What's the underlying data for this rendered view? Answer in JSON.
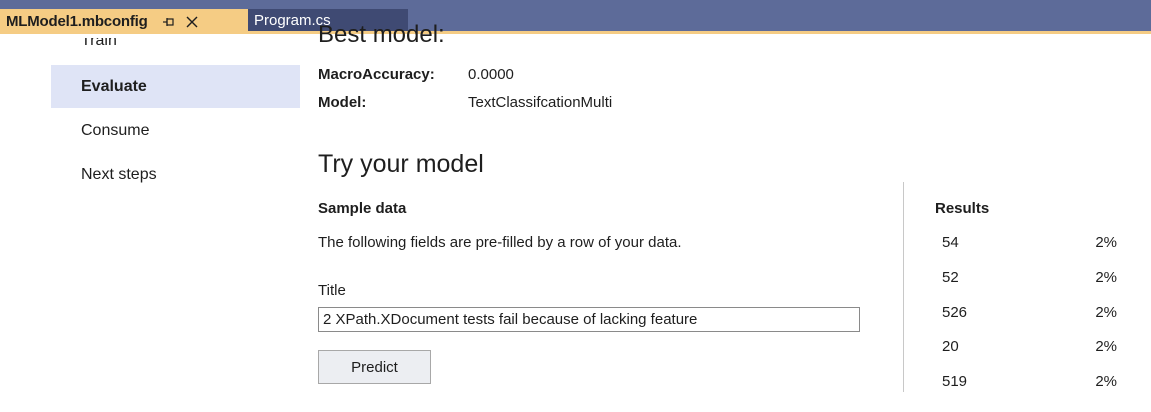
{
  "tabs": {
    "active": {
      "title": "MLModel1.mbconfig",
      "pin_icon": "pin-icon",
      "close_icon": "close-icon"
    },
    "inactive": {
      "title": "Program.cs"
    }
  },
  "nav": {
    "items": [
      {
        "label": "Train",
        "selected": false
      },
      {
        "label": "Evaluate",
        "selected": true
      },
      {
        "label": "Consume",
        "selected": false
      },
      {
        "label": "Next steps",
        "selected": false
      }
    ]
  },
  "best_model": {
    "heading": "Best model:",
    "macro_accuracy_label": "MacroAccuracy:",
    "macro_accuracy_value": "0.0000",
    "model_label": "Model:",
    "model_value": "TextClassifcationMulti"
  },
  "try_model": {
    "heading": "Try your model",
    "sample_heading": "Sample data",
    "sample_desc": "The following fields are pre-filled by a row of your data.",
    "field_label": "Title",
    "field_value": "2 XPath.XDocument tests fail because of lacking feature",
    "predict_label": "Predict"
  },
  "results": {
    "heading": "Results",
    "rows": [
      {
        "label": "54",
        "value": "2%"
      },
      {
        "label": "52",
        "value": "2%"
      },
      {
        "label": "526",
        "value": "2%"
      },
      {
        "label": "20",
        "value": "2%"
      },
      {
        "label": "519",
        "value": "2%"
      }
    ]
  },
  "colors": {
    "tab_strip": "#5d6b99",
    "active_tab": "#f5cc84",
    "inactive_tab": "#3f4a73",
    "nav_selected": "#dfe4f6"
  }
}
